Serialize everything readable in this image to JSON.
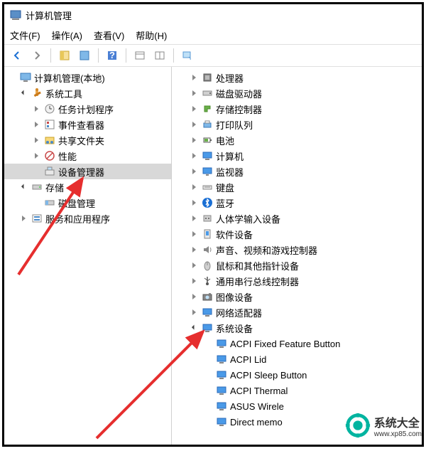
{
  "window": {
    "title": "计算机管理"
  },
  "menu": {
    "file": "文件(F)",
    "action": "操作(A)",
    "view": "查看(V)",
    "help": "帮助(H)"
  },
  "left_tree": {
    "root": "计算机管理(本地)",
    "system_tools": "系统工具",
    "task_scheduler": "任务计划程序",
    "event_viewer": "事件查看器",
    "shared_folders": "共享文件夹",
    "performance": "性能",
    "device_manager": "设备管理器",
    "storage": "存储",
    "disk_management": "磁盘管理",
    "services_apps": "服务和应用程序"
  },
  "right_tree": {
    "processors": "处理器",
    "disk_drives": "磁盘驱动器",
    "storage_controllers": "存储控制器",
    "print_queues": "打印队列",
    "batteries": "电池",
    "computer": "计算机",
    "monitors": "监视器",
    "keyboards": "键盘",
    "bluetooth": "蓝牙",
    "hid": "人体学输入设备",
    "software_devices": "软件设备",
    "sound": "声音、视频和游戏控制器",
    "mice": "鼠标和其他指针设备",
    "usb": "通用串行总线控制器",
    "imaging": "图像设备",
    "network": "网络适配器",
    "system_devices": "系统设备",
    "acpi_fixed": "ACPI Fixed Feature Button",
    "acpi_lid": "ACPI Lid",
    "acpi_sleep": "ACPI Sleep Button",
    "acpi_thermal": "ACPI Thermal",
    "asus_wireless": "ASUS Wirele",
    "direct_mem": "Direct memo"
  },
  "watermark": {
    "brand": "系统大全",
    "url": "www.xp85.com"
  }
}
